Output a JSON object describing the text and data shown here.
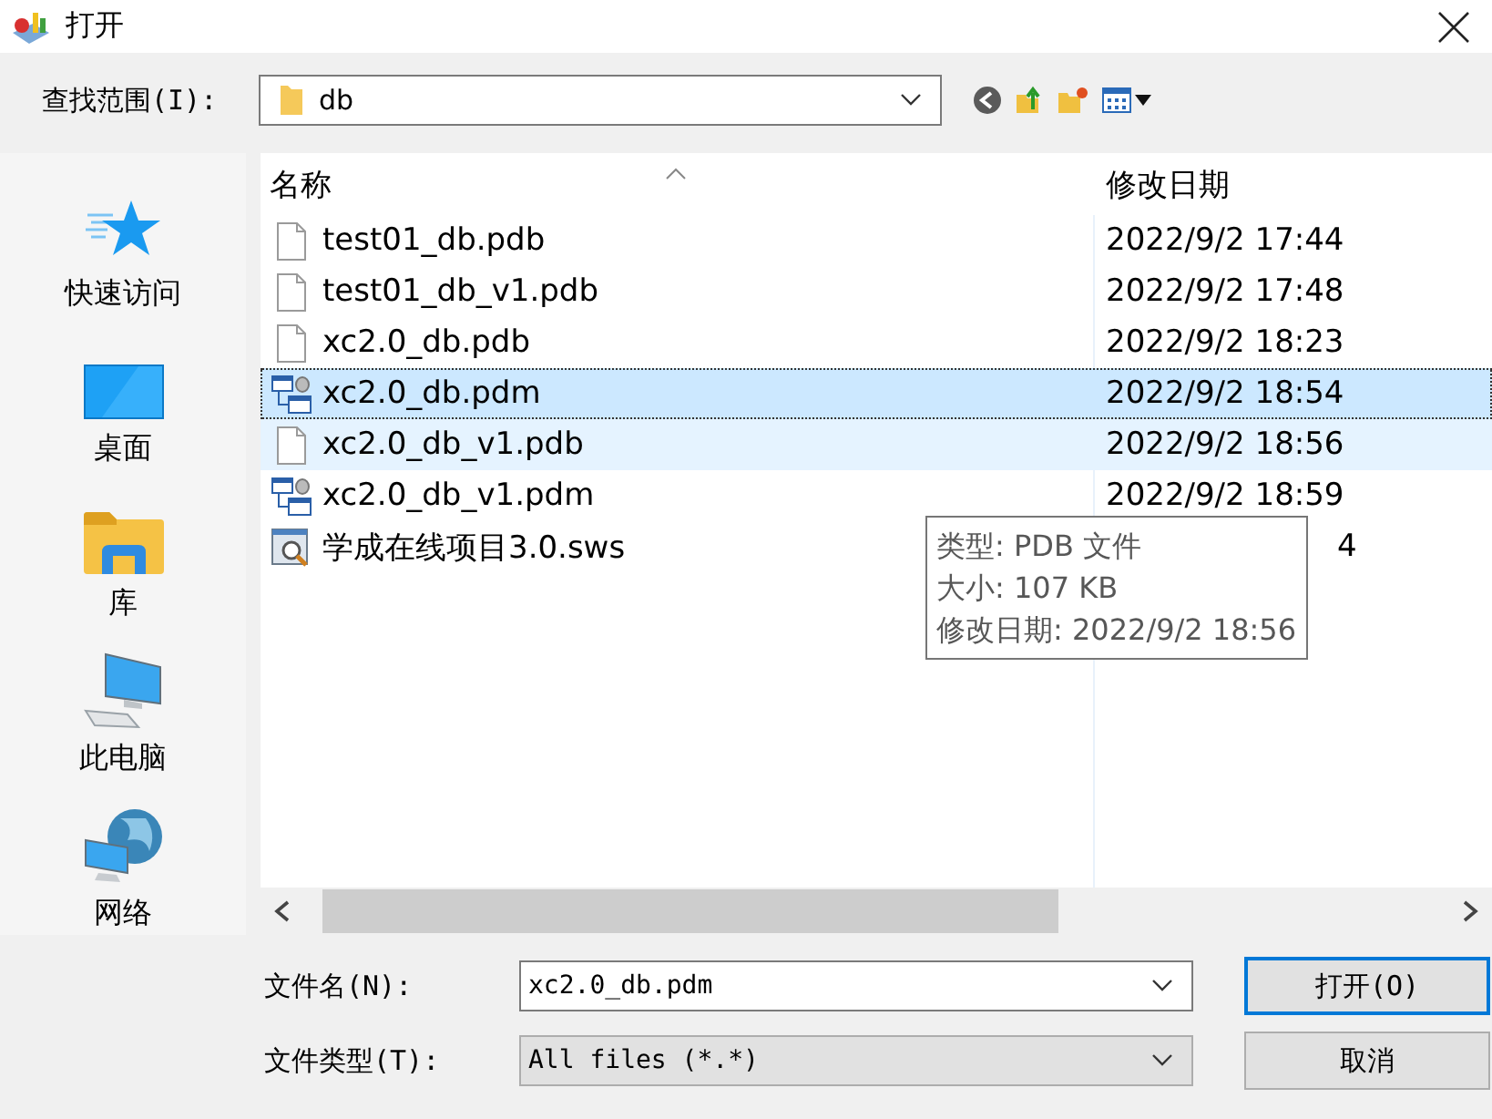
{
  "window": {
    "title": "打开"
  },
  "look_in": {
    "label": "查找范围(I):",
    "value": "db"
  },
  "sidebar": {
    "items": [
      {
        "label": "快速访问",
        "kind": "star"
      },
      {
        "label": "桌面",
        "kind": "desktop"
      },
      {
        "label": "库",
        "kind": "library"
      },
      {
        "label": "此电脑",
        "kind": "computer"
      },
      {
        "label": "网络",
        "kind": "network"
      }
    ]
  },
  "file_list": {
    "columns": [
      "名称",
      "修改日期"
    ],
    "rows": [
      {
        "name": "test01_db.pdb",
        "date": "2022/9/2 17:44",
        "kind": "file",
        "selected": false,
        "hovered": false,
        "covered": false
      },
      {
        "name": "test01_db_v1.pdb",
        "date": "2022/9/2 17:48",
        "kind": "file",
        "selected": false,
        "hovered": false,
        "covered": false
      },
      {
        "name": "xc2.0_db.pdb",
        "date": "2022/9/2 18:23",
        "kind": "file",
        "selected": false,
        "hovered": false,
        "covered": false
      },
      {
        "name": "xc2.0_db.pdm",
        "date": "2022/9/2 18:54",
        "kind": "model",
        "selected": true,
        "hovered": false,
        "covered": false
      },
      {
        "name": "xc2.0_db_v1.pdb",
        "date": "2022/9/2 18:56",
        "kind": "file",
        "selected": false,
        "hovered": true,
        "covered": false
      },
      {
        "name": "xc2.0_db_v1.pdm",
        "date": "2022/9/2 18:59",
        "kind": "model",
        "selected": false,
        "hovered": false,
        "covered": false
      },
      {
        "name": "学成在线项目3.0.sws",
        "date": "4",
        "kind": "workspace",
        "selected": false,
        "hovered": false,
        "covered": true
      }
    ],
    "tooltip": [
      "类型: PDB 文件",
      "大小: 107 KB",
      "修改日期: 2022/9/2 18:56"
    ]
  },
  "file_name": {
    "label": "文件名(N):",
    "value": "xc2.0_db.pdm"
  },
  "file_type": {
    "label": "文件类型(T):",
    "value": "All files (*.*)"
  },
  "buttons": [
    "打开(O)",
    "取消"
  ]
}
